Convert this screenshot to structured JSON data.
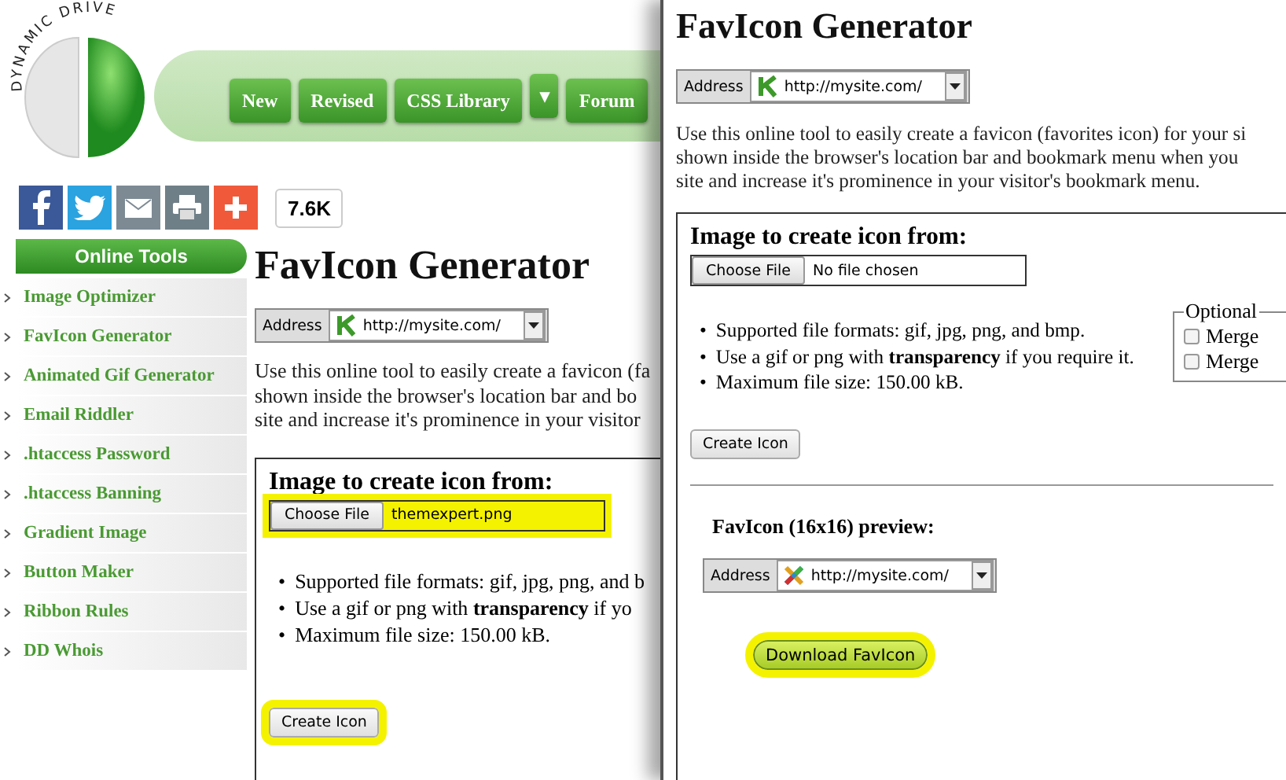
{
  "left_page": {
    "logo": {
      "text": "DYNAMIC DRIVE"
    },
    "nav": [
      {
        "label": "New",
        "kind": "button"
      },
      {
        "label": "Revised",
        "kind": "button"
      },
      {
        "label": "CSS Library",
        "kind": "button"
      },
      {
        "label": "▾",
        "kind": "dropdown"
      },
      {
        "label": "Forum",
        "kind": "button"
      }
    ],
    "share": {
      "count": "7.6K"
    },
    "sidebar": {
      "title": "Online Tools",
      "items": [
        "Image Optimizer",
        "FavIcon Generator",
        "Animated Gif Generator",
        "Email Riddler",
        ".htaccess Password",
        ".htaccess Banning",
        "Gradient Image",
        "Button Maker",
        "Ribbon Rules",
        "DD Whois"
      ]
    },
    "main": {
      "title": "FavIcon Generator",
      "address": {
        "label": "Address",
        "url": "http://mysite.com/"
      },
      "intro": [
        "Use this online tool to easily create a favicon (fa",
        "shown inside the browser's location bar and bo",
        "site and increase it's prominence in your visitor"
      ],
      "form": {
        "heading": "Image to create icon from:",
        "file_button": "Choose File",
        "file_value": "themexpert.png",
        "file_highlighted": true,
        "bullets": [
          {
            "marker": "•",
            "text": "Supported file formats: gif, jpg, png, and b"
          },
          {
            "marker": "•",
            "text": "Use a gif or png with **transparency** if yo"
          },
          {
            "marker": "•",
            "text": "Maximum file size: 150.00 kB."
          }
        ],
        "create_button": "Create Icon",
        "create_highlighted": true
      }
    }
  },
  "right_page": {
    "title": "FavIcon Generator",
    "address": {
      "label": "Address",
      "url": "http://mysite.com/"
    },
    "intro": [
      "Use this online tool to easily create a favicon (favorites icon) for your si",
      "shown inside the browser's location bar and bookmark menu when you",
      "site and increase it's prominence in your visitor's bookmark menu."
    ],
    "form": {
      "heading": "Image to create icon from:",
      "file_button": "Choose File",
      "file_value": "No file chosen",
      "file_highlighted": false,
      "bullets": [
        {
          "marker": "•",
          "text": "Supported file formats: gif, jpg, png, and bmp."
        },
        {
          "marker": "•",
          "text": "Use a gif or png with **transparency** if you require it."
        },
        {
          "marker": "•",
          "text": "Maximum file size: 150.00 kB."
        }
      ],
      "optional": {
        "legend": "Optional",
        "options": [
          {
            "label": "Merge",
            "checked": false
          },
          {
            "label": "Merge",
            "checked": false
          }
        ]
      },
      "create_button": "Create Icon",
      "create_highlighted": false
    },
    "preview": {
      "heading": "FavIcon (16x16) preview:",
      "address": {
        "label": "Address",
        "url": "http://mysite.com/"
      },
      "download_button": "Download FavIcon",
      "download_highlighted": true
    }
  }
}
